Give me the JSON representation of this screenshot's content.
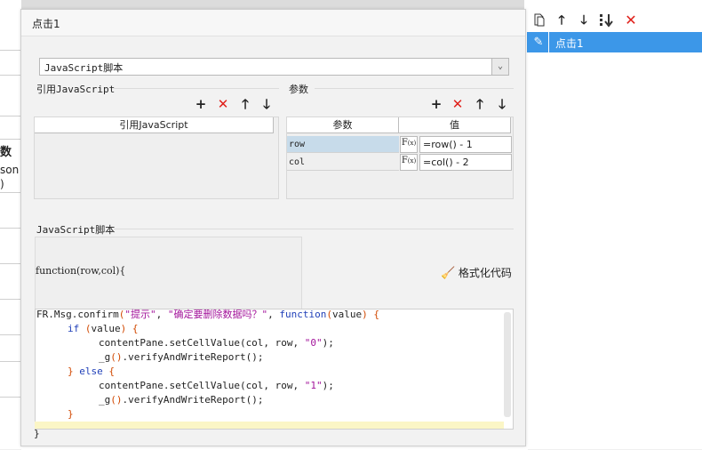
{
  "background": {
    "left_cells": [
      "数",
      "son",
      ")"
    ]
  },
  "dialog": {
    "title": "点击1",
    "script_type": {
      "selected": "JavaScript脚本"
    },
    "ref_js": {
      "section_label": "引用JavaScript",
      "column_header": "引用JavaScript"
    },
    "params": {
      "section_label": "参数",
      "col_name": "参数",
      "col_value": "值",
      "rows": [
        {
          "name": "row",
          "value": "=row() - 1"
        },
        {
          "name": "col",
          "value": "=col() - 2"
        }
      ]
    },
    "script": {
      "section_label": "JavaScript脚本",
      "signature": "function(row,col){",
      "format_button": "格式化代码",
      "closing": "}",
      "code": {
        "l1_obj": "FR.Msg.confirm",
        "l1_str1": "\"提示\"",
        "l1_str2": "\"确定要删除数据吗？\"",
        "l1_fn": "function",
        "l1_arg": "value",
        "l2_if": "if",
        "l2_arg": "value",
        "l3": "contentPane.setCellValue(col, row, ",
        "l3_str": "\"0\"",
        "l3_end": ");",
        "l4": "_g",
        "l4_rest": ".verifyAndWriteReport();",
        "l5_else": "else",
        "l6": "contentPane.setCellValue(col, row, ",
        "l6_str": "\"1\"",
        "l6_end": ");",
        "l7": "_g",
        "l7_rest": ".verifyAndWriteReport();"
      }
    }
  },
  "right_panel": {
    "items": [
      {
        "label": "点击1"
      }
    ]
  },
  "colors": {
    "accent": "#3c97e8",
    "delete": "#e0201a",
    "keyword": "#1f3fb8",
    "string": "#a3159b",
    "punct": "#d14800"
  }
}
